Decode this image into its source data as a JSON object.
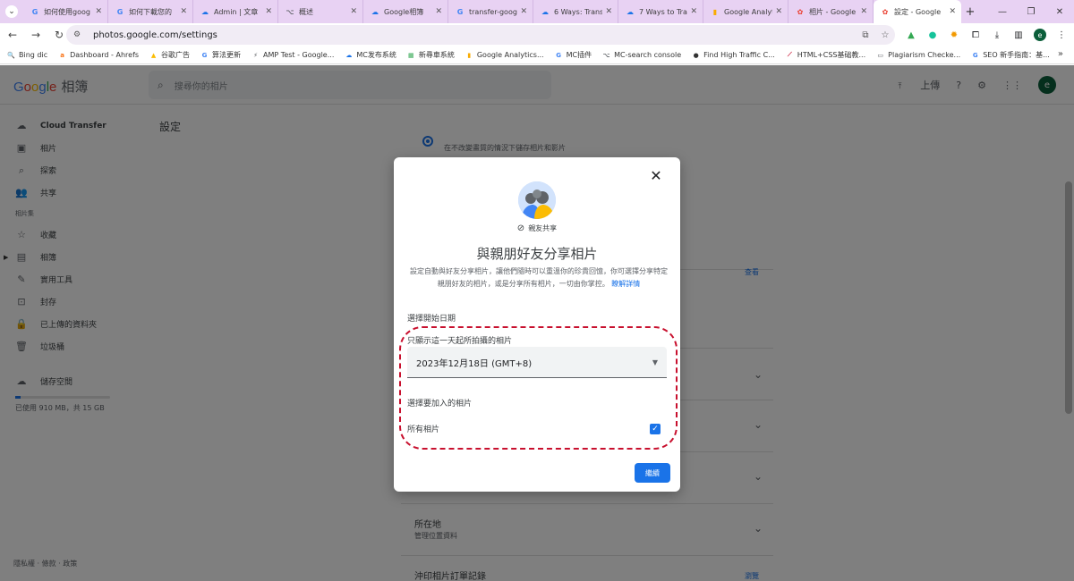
{
  "browser": {
    "tabs": [
      {
        "title": "如何使用goog",
        "fav": "G",
        "color": "#4285f4"
      },
      {
        "title": "如何下載您的",
        "fav": "G",
        "color": "#4285f4"
      },
      {
        "title": "Admin | 文章",
        "fav": "☁",
        "color": "#1a73e8"
      },
      {
        "title": "概述",
        "fav": "⌥",
        "color": "#5f6368"
      },
      {
        "title": "Google相簿",
        "fav": "☁",
        "color": "#1a73e8"
      },
      {
        "title": "transfer-goog",
        "fav": "G",
        "color": "#4285f4"
      },
      {
        "title": "6 Ways: Transf",
        "fav": "☁",
        "color": "#1a73e8"
      },
      {
        "title": "7 Ways to Tra",
        "fav": "☁",
        "color": "#1a73e8"
      },
      {
        "title": "Google Analyt",
        "fav": "▮",
        "color": "#f9ab00"
      },
      {
        "title": "相片 - Google",
        "fav": "✿",
        "color": "#ea4335"
      },
      {
        "title": "設定 - Google",
        "fav": "✿",
        "color": "#ea4335",
        "active": true
      }
    ],
    "url": "photos.google.com/settings",
    "profile_initial": "e",
    "bookmarks": [
      {
        "label": "Bing dic",
        "fav": "🔍",
        "color": "#1a73e8"
      },
      {
        "label": "Dashboard - Ahrefs",
        "fav": "a",
        "color": "#f97316"
      },
      {
        "label": "谷歌广告",
        "fav": "▲",
        "color": "#fbbc04"
      },
      {
        "label": "算法更新",
        "fav": "G",
        "color": "#4285f4"
      },
      {
        "label": "AMP Test - Google...",
        "fav": "⚡",
        "color": "#5f6368"
      },
      {
        "label": "MC发布系统",
        "fav": "☁",
        "color": "#1a73e8"
      },
      {
        "label": "新尋車系統",
        "fav": "▦",
        "color": "#34a853"
      },
      {
        "label": "Google Analytics...",
        "fav": "▮",
        "color": "#f9ab00"
      },
      {
        "label": "MC插件",
        "fav": "G",
        "color": "#4285f4"
      },
      {
        "label": "MC-search console",
        "fav": "⌥",
        "color": "#5f6368"
      },
      {
        "label": "Find High Traffic C...",
        "fav": "●",
        "color": "#333333"
      },
      {
        "label": "HTML+CSS基础教...",
        "fav": "⟋",
        "color": "#c8102e"
      },
      {
        "label": "Plagiarism Checke...",
        "fav": "▭",
        "color": "#5f6368"
      },
      {
        "label": "SEO 新手指南：基...",
        "fav": "G",
        "color": "#4285f4"
      }
    ]
  },
  "app": {
    "logo_google": "Google",
    "logo_product": "相簿",
    "search_placeholder": "搜尋你的相片",
    "upload_label": "上傳",
    "avatar_initial": "e",
    "sidebar": {
      "cloud_transfer": "Cloud Transfer",
      "items_top": [
        "相片",
        "探索",
        "共享"
      ],
      "section_label": "相片集",
      "items_library": [
        "收藏",
        "相簿",
        "實用工具",
        "封存",
        "已上傳的資料夾",
        "垃圾桶"
      ],
      "storage_label": "儲存空間",
      "storage_used": "已使用 910 MB，共 15 GB",
      "storage_fraction": 0.06
    },
    "footer": "隱私權 · 條款 · 政策",
    "settings_title": "設定",
    "radio_label": "在不改變畫質的情況下儲存相片和影片",
    "view_link_1": "查看",
    "partial_row_text": "識",
    "location_label": "所在地",
    "location_sub": "管理位置資料",
    "print_label": "沖印相片訂單記錄",
    "print_sub": "查看你的訂單記錄",
    "view_link_2": "瀏覽"
  },
  "dialog": {
    "badge": "親友共享",
    "title": "與親朋好友分享相片",
    "description": "設定自動與好友分享相片，讓他們隨時可以重溫你的珍貴回憶，你可選擇分享特定親朋好友的相片，或是分享所有相片，一切由你掌控。",
    "learn_more": "瞭解詳情",
    "start_date_heading": "選擇開始日期",
    "date_field_label": "只顯示這一天起所拍攝的相片",
    "date_value": "2023年12月18日 (GMT+8)",
    "photos_heading": "選擇要加入的相片",
    "all_photos_label": "所有相片",
    "all_photos_checked": true,
    "continue_label": "繼續",
    "close_label": "✕"
  }
}
